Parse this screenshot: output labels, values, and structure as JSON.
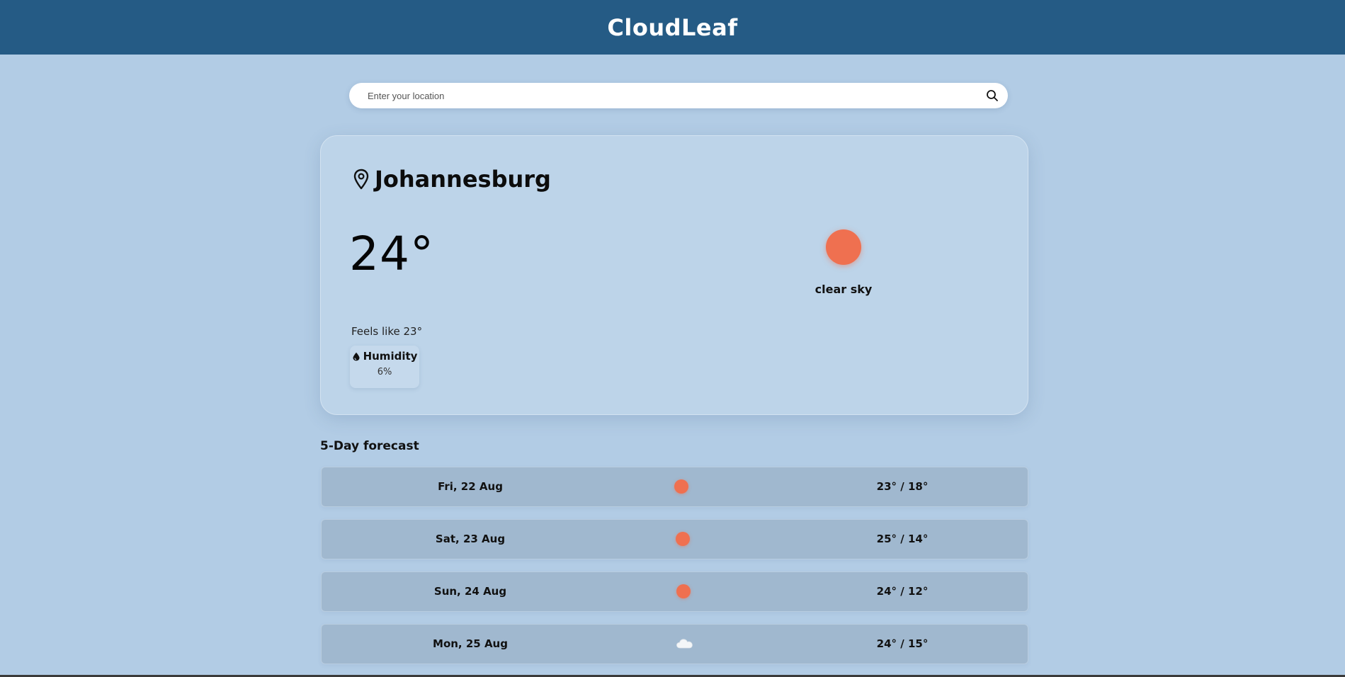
{
  "header": {
    "title": "CloudLeaf"
  },
  "search": {
    "placeholder": "Enter your location",
    "value": "",
    "icon": "search-icon"
  },
  "current": {
    "city": "Johannesburg",
    "city_icon": "location-pin-icon",
    "temperature": "24°",
    "condition": "clear sky",
    "condition_icon": "sun-icon",
    "feels_like": "Feels like 23°",
    "humidity": {
      "label": "Humidity",
      "value": "6%",
      "icon": "droplet-icon"
    }
  },
  "forecast": {
    "title": "5-Day forecast",
    "days": [
      {
        "date": "Fri, 22 Aug",
        "icon": "sun-icon",
        "temps": "23° / 18°"
      },
      {
        "date": "Sat, 23 Aug",
        "icon": "sun-icon",
        "temps": "25° / 14°"
      },
      {
        "date": "Sun, 24 Aug",
        "icon": "sun-icon",
        "temps": "24° / 12°"
      },
      {
        "date": "Mon, 25 Aug",
        "icon": "cloud-icon",
        "temps": "24° / 15°"
      }
    ]
  },
  "colors": {
    "header": "#255b85",
    "background": "#b2cce5",
    "card": "#bdd4e9",
    "forecast_row": "#a0b8cf",
    "sun": "#ef7050"
  }
}
